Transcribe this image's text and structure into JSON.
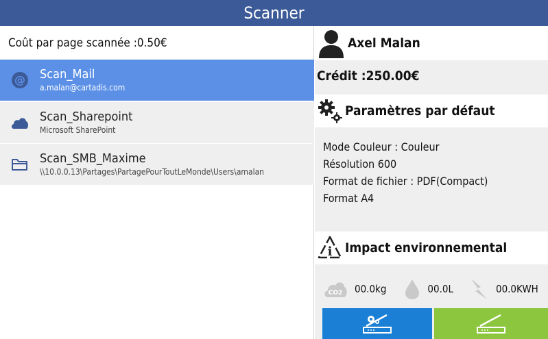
{
  "header": {
    "title": "Scanner"
  },
  "cost": {
    "label": "Coût par page scannée :0.50€"
  },
  "scan_list": {
    "items": [
      {
        "name": "Scan_Mail",
        "detail": "a.malan@cartadis.com",
        "icon": "at-icon"
      },
      {
        "name": "Scan_Sharepoint",
        "detail": "Microsoft SharePoint",
        "icon": "cloud-icon"
      },
      {
        "name": "Scan_SMB_Maxime",
        "detail": "\\\\10.0.0.13\\Partages\\PartagePourToutLeMonde\\Users\\amalan",
        "icon": "folder-icon"
      }
    ]
  },
  "user": {
    "name": "Axel Malan"
  },
  "credit": {
    "label": "Crédit :250.00€"
  },
  "defaults": {
    "title": "Paramètres par défaut",
    "lines": [
      "Mode Couleur : Couleur",
      "Résolution 600",
      "Format de fichier : PDF(Compact)",
      "Format A4"
    ]
  },
  "environment": {
    "title": "Impact environnemental",
    "co2": "00.0kg",
    "water": "00.0L",
    "energy": "00.0KWH"
  },
  "colors": {
    "title_bar": "#3c5a98",
    "selected_item": "#5b90e6",
    "settings_button": "#1b7fd6",
    "scan_button": "#8cc63f"
  }
}
